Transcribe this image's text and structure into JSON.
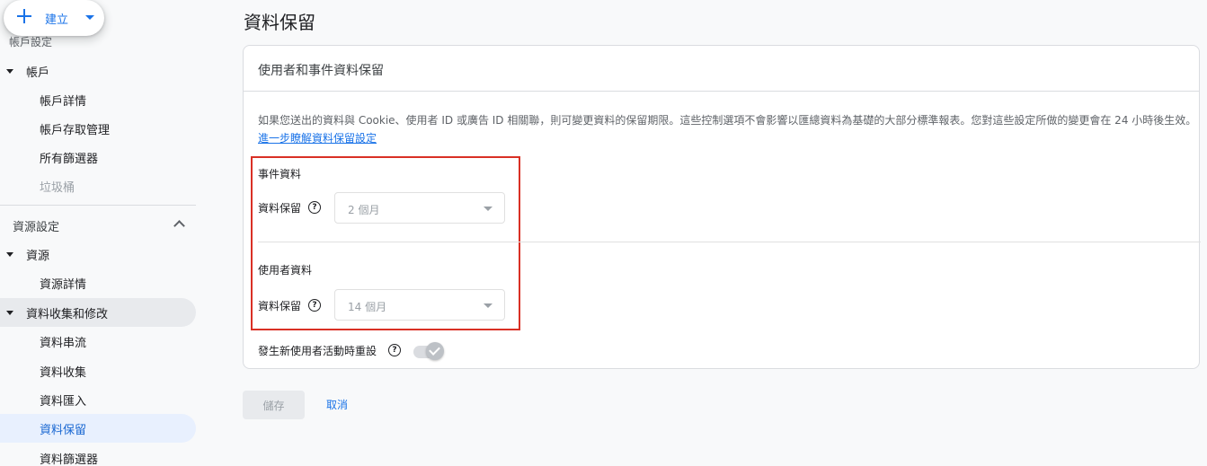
{
  "sidebar": {
    "create_label": "建立",
    "partial_top_label": "帳戶設定",
    "items": [
      {
        "label": "帳戶"
      },
      {
        "label": "帳戶詳情"
      },
      {
        "label": "帳戶存取管理"
      },
      {
        "label": "所有篩選器"
      },
      {
        "label": "垃圾桶"
      },
      {
        "label": "資源設定"
      },
      {
        "label": "資源"
      },
      {
        "label": "資源詳情"
      },
      {
        "label": "資料收集和修改"
      },
      {
        "label": "資料串流"
      },
      {
        "label": "資料收集"
      },
      {
        "label": "資料匯入"
      },
      {
        "label": "資料保留"
      },
      {
        "label": "資料篩選器"
      }
    ]
  },
  "main": {
    "page_title": "資料保留",
    "card_title": "使用者和事件資料保留",
    "description": "如果您送出的資料與 Cookie、使用者 ID 或廣告 ID 相關聯，則可變更資料的保留期限。這些控制選項不會影響以匯總資料為基礎的大部分標準報表。您對這些設定所做的變更會在 24 小時後生效。",
    "learn_more_link": "進一步瞭解資料保留設定",
    "event_section": {
      "heading": "事件資料",
      "field_label": "資料保留",
      "value": "2 個月"
    },
    "user_section": {
      "heading": "使用者資料",
      "field_label": "資料保留",
      "value": "14 個月"
    },
    "reset_toggle": {
      "label": "發生新使用者活動時重設",
      "on": true
    },
    "save_label": "儲存",
    "cancel_label": "取消"
  },
  "colors": {
    "accent": "#1a73e8",
    "highlight_box": "#d93025",
    "active_nav_bg": "#e8f0fe"
  }
}
